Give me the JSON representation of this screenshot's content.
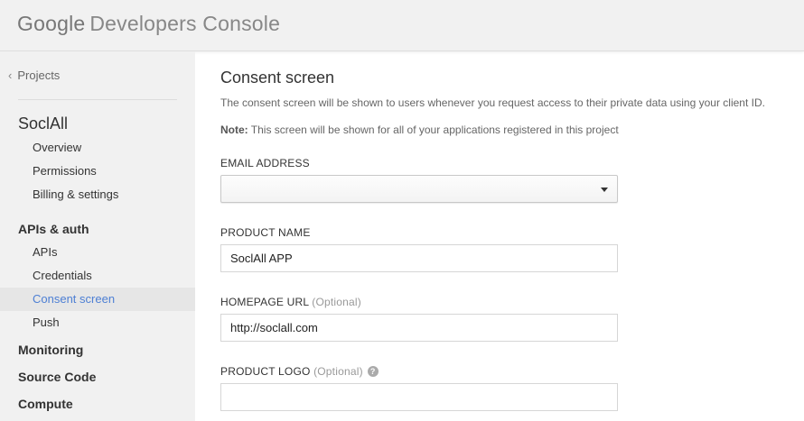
{
  "header": {
    "brand_google": "Google",
    "brand_product": "Developers Console"
  },
  "sidebar": {
    "back_label": "Projects",
    "project_name": "SoclAll",
    "project_items": [
      {
        "label": "Overview"
      },
      {
        "label": "Permissions"
      },
      {
        "label": "Billing & settings"
      }
    ],
    "apis_section": "APIs & auth",
    "apis_items": [
      {
        "label": "APIs"
      },
      {
        "label": "Credentials"
      },
      {
        "label": "Consent screen",
        "active": true
      },
      {
        "label": "Push"
      }
    ],
    "sections": [
      {
        "label": "Monitoring"
      },
      {
        "label": "Source Code"
      },
      {
        "label": "Compute"
      }
    ]
  },
  "main": {
    "title": "Consent screen",
    "description": "The consent screen will be shown to users whenever you request access to their private data using your client ID.",
    "note_label": "Note:",
    "note_text": " This screen will be shown for all of your applications registered in this project",
    "email": {
      "label": "EMAIL ADDRESS",
      "value": ""
    },
    "product_name": {
      "label": "PRODUCT NAME",
      "value": "SoclAll APP"
    },
    "homepage": {
      "label": "HOMEPAGE URL",
      "optional": "(Optional)",
      "value": "http://soclall.com"
    },
    "logo": {
      "label": "PRODUCT LOGO",
      "optional": "(Optional)",
      "value": ""
    }
  },
  "colors": {
    "accent": "#4d7fd4",
    "sidebar_bg": "#f1f1f1"
  }
}
